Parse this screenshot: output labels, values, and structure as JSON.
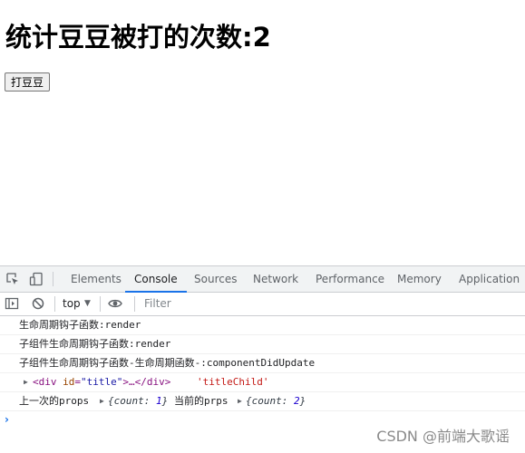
{
  "page": {
    "heading": "统计豆豆被打的次数:2",
    "button_label": "打豆豆"
  },
  "devtools": {
    "tabs": [
      "Elements",
      "Console",
      "Sources",
      "Network",
      "Performance",
      "Memory",
      "Application"
    ],
    "active_tab": "Console",
    "context": "top",
    "filter_placeholder": "Filter",
    "accent_color": "#1a73e8"
  },
  "console": {
    "messages": [
      {
        "text": "生命周期钩子函数:render"
      },
      {
        "text": "子组件生命周期钩子函数:render"
      },
      {
        "text": "子组件生命周期钩子函数-生命周期函数-:componentDidUpdate"
      },
      {
        "tag_open": "<div ",
        "attr_name": "id",
        "attr_eq": "=",
        "attr_value": "\"title\"",
        "tag_rest": ">…</div>",
        "string": "'titleChild'"
      },
      {
        "label_prev": "上一次的props",
        "prev_obj_open": "{count: ",
        "prev_count": "1",
        "prev_obj_close": "}",
        "label_curr": "当前的prps",
        "curr_obj_open": "{count: ",
        "curr_count": "2",
        "curr_obj_close": "}"
      }
    ],
    "prompt": "›"
  },
  "watermark": "CSDN @前端大歌谣"
}
